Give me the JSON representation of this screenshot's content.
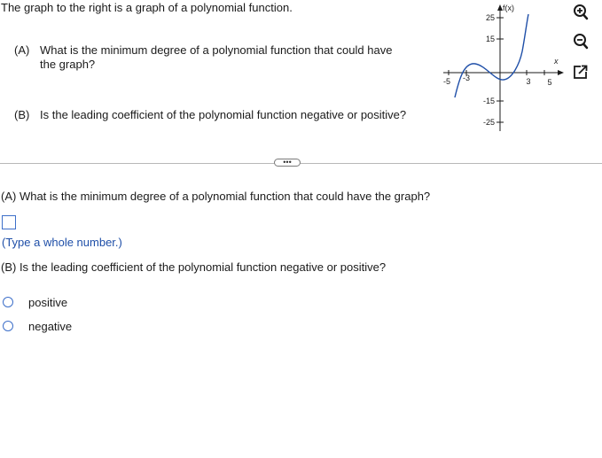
{
  "intro": "The graph to the right is a graph of a polynomial function.",
  "question_a": {
    "label": "(A)",
    "text": "What is the minimum degree of a polynomial function that could have the graph?"
  },
  "question_b": {
    "label": "(B)",
    "text": "Is the leading coefficient of the polynomial function negative or positive?"
  },
  "more_button": "•••",
  "answer_a": {
    "prompt": "(A) What is the minimum degree of a polynomial function that could have the graph?",
    "value": "",
    "hint": "(Type a whole number.)"
  },
  "answer_b": {
    "prompt": "(B) Is the leading coefficient of the polynomial function negative or positive?",
    "options": [
      "positive",
      "negative"
    ]
  },
  "graph": {
    "y_axis_label": "f(x)",
    "x_axis_label": "x",
    "y_ticks": [
      "25",
      "15",
      "-15",
      "-25"
    ],
    "x_ticks": [
      "-5",
      "-3",
      "3",
      "5"
    ],
    "curve_color": "#1f4fa8"
  },
  "tools": [
    "zoom-in-icon",
    "zoom-out-icon",
    "pop-out-icon"
  ]
}
